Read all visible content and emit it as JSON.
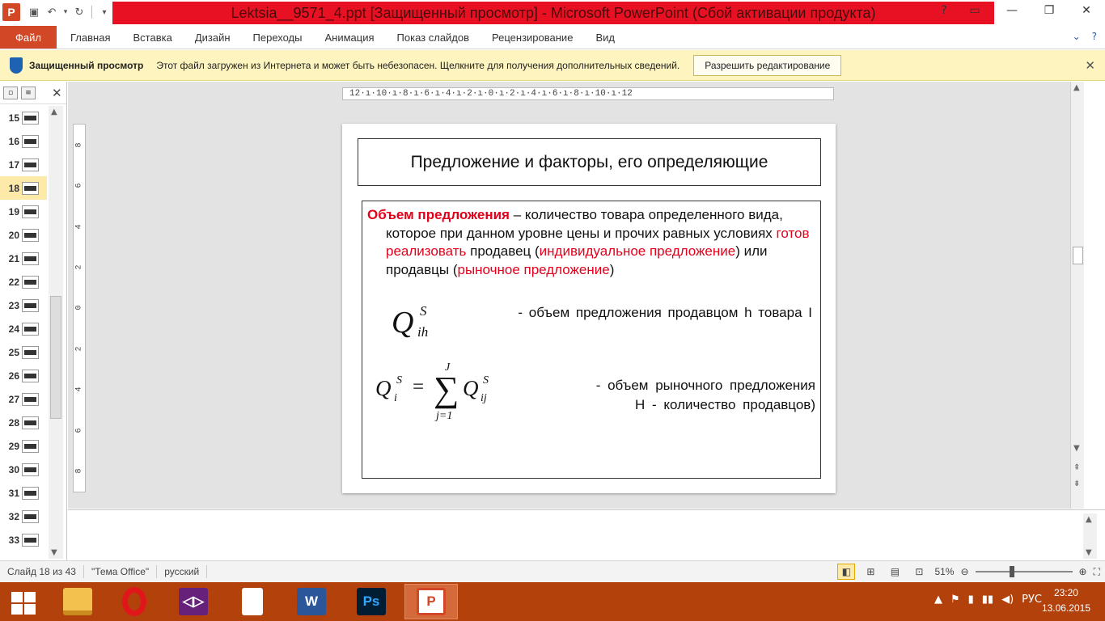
{
  "window": {
    "title": "Lektsia__9571_4.ppt [Защищенный просмотр] - Microsoft PowerPoint (Сбой активации продукта)",
    "app_logo": "P",
    "accent": "#d24726",
    "title_bg": "#e81123"
  },
  "ribbon": {
    "file_label": "Файл",
    "tabs": [
      "Главная",
      "Вставка",
      "Дизайн",
      "Переходы",
      "Анимация",
      "Показ слайдов",
      "Рецензирование",
      "Вид"
    ]
  },
  "message_bar": {
    "title": "Защищенный просмотр",
    "text": "Этот файл загружен из Интернета и может быть небезопасен. Щелкните для получения дополнительных сведений.",
    "button": "Разрешить редактирование"
  },
  "slides_pane": {
    "numbers": [
      "15",
      "16",
      "17",
      "18",
      "19",
      "20",
      "21",
      "22",
      "23",
      "24",
      "25",
      "26",
      "27",
      "28",
      "29",
      "30",
      "31",
      "32",
      "33"
    ],
    "selected": "18"
  },
  "ruler": {
    "h_ticks": "12·ı·10·ı·8·ı·6·ı·4·ı·2·ı·0·ı·2·ı·4·ı·6·ı·8·ı·10·ı·12",
    "v_ticks": [
      "8",
      "6",
      "4",
      "2",
      "0",
      "2",
      "4",
      "6",
      "8"
    ]
  },
  "slide": {
    "title": "Предложение и факторы, его определяющие",
    "term": "Объем предложения",
    "text_a": " – количество товара определенного вида, которое при данном уровне цены и прочих равных условиях ",
    "red_1": "готов реализовать",
    "text_b": " продавец (",
    "red_2": "индивидуальное предложение",
    "text_c": ")  или продавцы (",
    "red_3": "рыночное предложение",
    "text_d": ")",
    "formula1": {
      "base": "Q",
      "sup": "S",
      "sub": "ih"
    },
    "formula1_desc": "- объем предложения  продавцом h товара I",
    "formula2": {
      "lhs": "Q",
      "lhs_sup": "S",
      "lhs_sub": "i",
      "eq": "=",
      "sum": "∑",
      "upper": "J",
      "lower": "j=1",
      "rhs": "Q",
      "rhs_sup": "S",
      "rhs_sub": "ij"
    },
    "formula2_desc_1": "- объем  рыночного  предложения",
    "formula2_desc_2": "H - количество  продавцов)"
  },
  "status": {
    "slide_info": "Слайд 18 из 43",
    "theme": "\"Тема Office\"",
    "language": "русский",
    "zoom": "51%"
  },
  "taskbar": {
    "apps": [
      "file-explorer-icon",
      "opera-icon",
      "visual-studio-icon",
      "document-icon",
      "word-icon",
      "photoshop-icon",
      "powerpoint-icon"
    ],
    "word_label": "W",
    "ps_label": "Ps",
    "lang": "РУС",
    "time": "23:20",
    "date": "13.06.2015"
  }
}
